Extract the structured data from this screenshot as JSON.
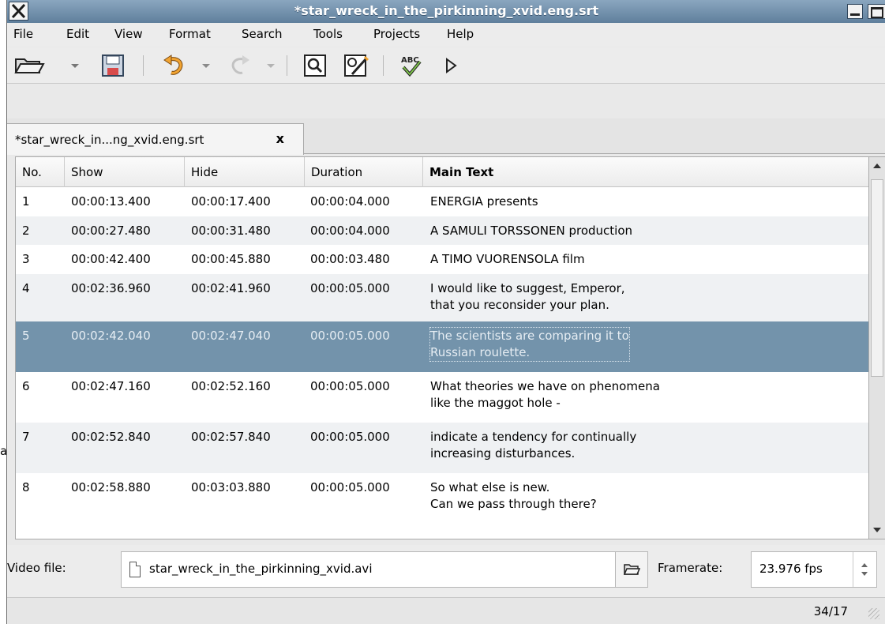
{
  "stray_text": "a",
  "window": {
    "title": "*star_wreck_in_the_pirkinning_xvid.eng.srt"
  },
  "menu": [
    "File",
    "Edit",
    "View",
    "Format",
    "Search",
    "Tools",
    "Projects",
    "Help"
  ],
  "toolbar_icons": [
    "open-folder-icon",
    "dropdown-arrow-icon",
    "save-icon",
    "undo-icon",
    "dropdown-arrow-icon",
    "redo-icon",
    "dropdown-arrow-icon",
    "find-icon",
    "find-replace-icon",
    "spellcheck-icon",
    "play-icon"
  ],
  "tab": {
    "label": "*star_wreck_in...ng_xvid.eng.srt",
    "close_glyph": "x"
  },
  "table": {
    "columns": [
      "No.",
      "Show",
      "Hide",
      "Duration",
      "Main Text"
    ],
    "rows": [
      {
        "no": "1",
        "show": "00:00:13.400",
        "hide": "00:00:17.400",
        "duration": "00:00:04.000",
        "text": "ENERGIA presents"
      },
      {
        "no": "2",
        "show": "00:00:27.480",
        "hide": "00:00:31.480",
        "duration": "00:00:04.000",
        "text": "A SAMULI TORSSONEN production"
      },
      {
        "no": "3",
        "show": "00:00:42.400",
        "hide": "00:00:45.880",
        "duration": "00:00:03.480",
        "text": "A TIMO VUORENSOLA film"
      },
      {
        "no": "4",
        "show": "00:02:36.960",
        "hide": "00:02:41.960",
        "duration": "00:00:05.000",
        "text": "I would like to suggest, Emperor,\nthat you reconsider your plan."
      },
      {
        "no": "5",
        "show": "00:02:42.040",
        "hide": "00:02:47.040",
        "duration": "00:00:05.000",
        "text": "The scientists are comparing it to\nRussian roulette."
      },
      {
        "no": "6",
        "show": "00:02:47.160",
        "hide": "00:02:52.160",
        "duration": "00:00:05.000",
        "text": "What theories we have on phenomena\nlike the maggot hole -"
      },
      {
        "no": "7",
        "show": "00:02:52.840",
        "hide": "00:02:57.840",
        "duration": "00:00:05.000",
        "text": "indicate a tendency for continually\nincreasing disturbances."
      },
      {
        "no": "8",
        "show": "00:02:58.880",
        "hide": "00:03:03.880",
        "duration": "00:00:05.000",
        "text": "So what else is new.\nCan we pass through there?"
      }
    ],
    "selected_row": 5
  },
  "video": {
    "label": "Video file:",
    "file": "star_wreck_in_the_pirkinning_xvid.avi",
    "framerate_label": "Framerate:",
    "framerate_value": "23.976 fps"
  },
  "status": {
    "position": "34/17"
  },
  "colors": {
    "titlebar": "#6f8ead",
    "selection": "#7393ab",
    "alt_row": "#eff1f3"
  }
}
